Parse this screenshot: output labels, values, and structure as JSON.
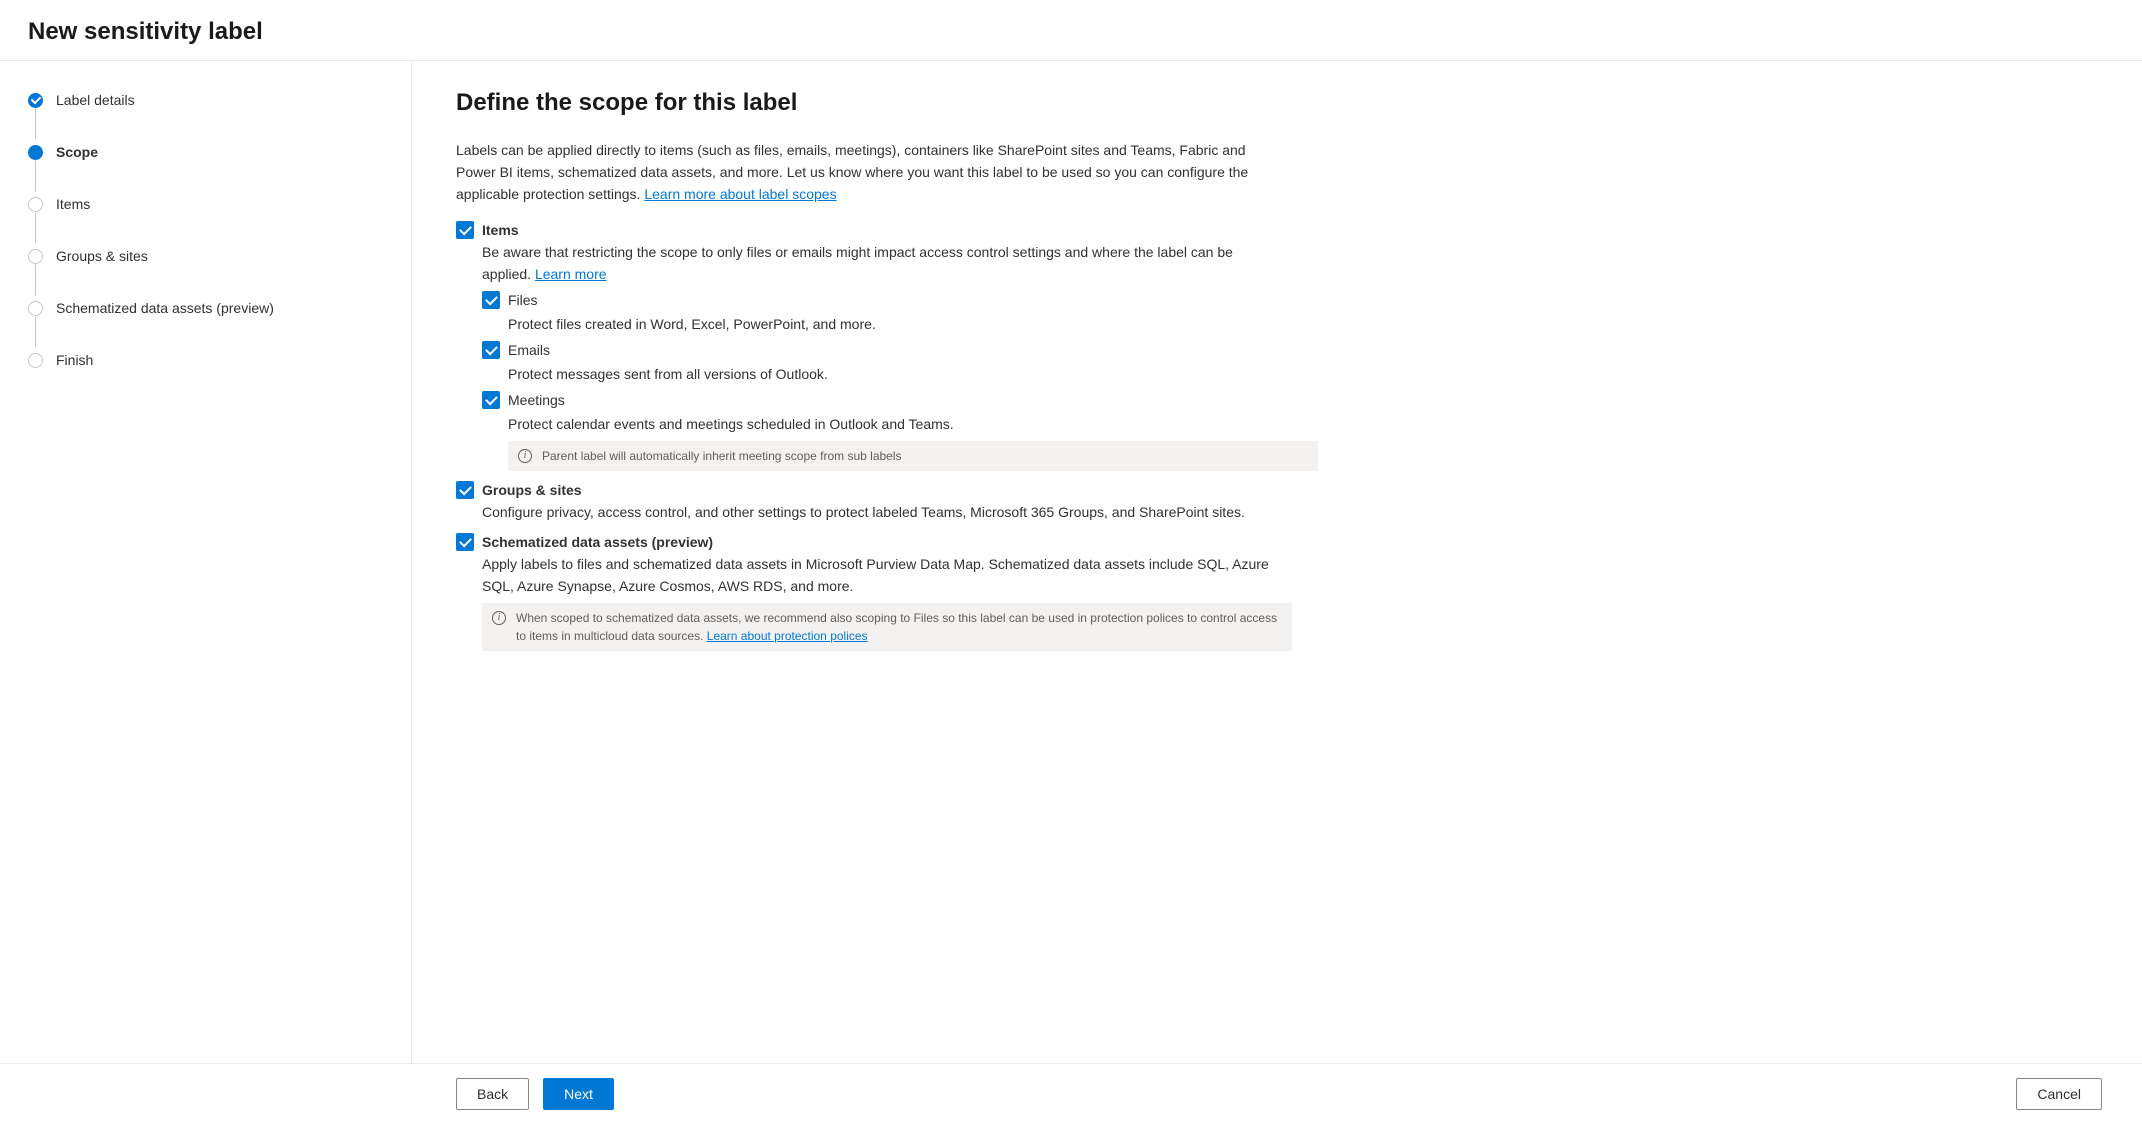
{
  "header": {
    "title": "New sensitivity label"
  },
  "sidebar": {
    "steps": [
      {
        "label": "Label details"
      },
      {
        "label": "Scope"
      },
      {
        "label": "Items"
      },
      {
        "label": "Groups & sites"
      },
      {
        "label": "Schematized data assets (preview)"
      },
      {
        "label": "Finish"
      }
    ]
  },
  "main": {
    "heading": "Define the scope for this label",
    "description": "Labels can be applied directly to items (such as files, emails, meetings), containers like SharePoint sites and Teams, Fabric and Power BI items, schematized data assets, and more. Let us know where you want this label to be used so you can configure the applicable protection settings. ",
    "learn_link": "Learn more about label scopes",
    "items": {
      "label": "Items",
      "desc_prefix": "Be aware that restricting the scope to only files or emails might impact access control settings and where the label can be applied. ",
      "learn_more": "Learn more",
      "sub": {
        "files": {
          "label": "Files",
          "desc": "Protect files created in Word, Excel, PowerPoint, and more."
        },
        "emails": {
          "label": "Emails",
          "desc": "Protect messages sent from all versions of Outlook."
        },
        "meetings": {
          "label": "Meetings",
          "desc": "Protect calendar events and meetings scheduled in Outlook and Teams."
        }
      },
      "meetings_info": "Parent label will automatically inherit meeting scope from sub labels"
    },
    "groups": {
      "label": "Groups & sites",
      "desc": "Configure privacy, access control, and other settings to protect labeled Teams, Microsoft 365 Groups, and SharePoint sites."
    },
    "schematized": {
      "label": "Schematized data assets (preview)",
      "desc": "Apply labels to files and schematized data assets in Microsoft Purview Data Map. Schematized data assets include SQL, Azure SQL, Azure Synapse, Azure Cosmos, AWS RDS, and more.",
      "info_prefix": "When scoped to schematized data assets, we recommend also scoping to Files so this label can be used in protection polices to control access to items in multicloud data sources. ",
      "info_link": "Learn about protection polices"
    }
  },
  "footer": {
    "back": "Back",
    "next": "Next",
    "cancel": "Cancel"
  }
}
